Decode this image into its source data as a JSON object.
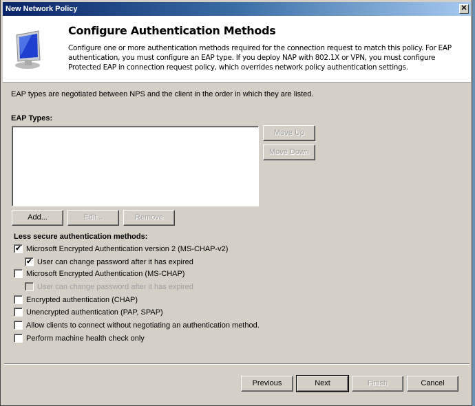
{
  "window": {
    "title": "New Network Policy",
    "close": "✕"
  },
  "header": {
    "title": "Configure Authentication Methods",
    "description": "Configure one or more authentication methods required for the connection request to match this policy. For EAP authentication, you must configure an EAP type. If you deploy NAP with 802.1X or VPN, you must configure Protected EAP in connection request policy, which overrides network policy authentication settings."
  },
  "intro": "EAP types are negotiated between NPS and the client in the order in which they are listed.",
  "eap": {
    "label": "EAP Types:",
    "items": [],
    "move_up": "Move Up",
    "move_down": "Move Down",
    "add": "Add...",
    "edit": "Edit...",
    "remove": "Remove"
  },
  "less_secure": {
    "label": "Less secure authentication methods:",
    "options": [
      {
        "label": "Microsoft Encrypted Authentication version 2 (MS-CHAP-v2)",
        "checked": true,
        "enabled": true
      },
      {
        "label": "User can change password after it has expired",
        "checked": true,
        "enabled": true
      },
      {
        "label": "Microsoft Encrypted Authentication (MS-CHAP)",
        "checked": false,
        "enabled": true
      },
      {
        "label": "User can change password after it has expired",
        "checked": false,
        "enabled": false
      },
      {
        "label": "Encrypted authentication (CHAP)",
        "checked": false,
        "enabled": true
      },
      {
        "label": "Unencrypted authentication (PAP, SPAP)",
        "checked": false,
        "enabled": true
      },
      {
        "label": "Allow clients to connect without negotiating an authentication method.",
        "checked": false,
        "enabled": true
      },
      {
        "label": "Perform machine health check only",
        "checked": false,
        "enabled": true
      }
    ]
  },
  "footer": {
    "previous": "Previous",
    "next": "Next",
    "finish": "Finish",
    "cancel": "Cancel"
  }
}
